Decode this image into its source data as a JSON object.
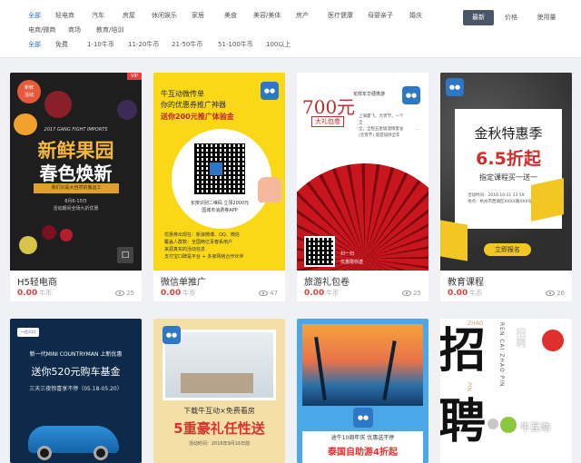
{
  "filters": {
    "row1": [
      "全部",
      "轻电商",
      "汽车",
      "房屋",
      "休闲娱乐",
      "家居",
      "美食",
      "美容/美体",
      "房产",
      "医疗健康",
      "母婴亲子",
      "婚庆"
    ],
    "row2": [
      "电商/微商",
      "商场",
      "教育/培训"
    ],
    "row3": [
      "全部",
      "免费",
      "1-10牛币",
      "11-20牛币",
      "21-50牛币",
      "51-100牛币",
      "100以上"
    ]
  },
  "sort": {
    "latest": "最新",
    "price": "价格",
    "usage": "使用量"
  },
  "cards": [
    {
      "title": "H5轻电商",
      "price": "0.00",
      "unit": "牛币",
      "views": "25",
      "thumb": {
        "badge": "新鲜\n活动",
        "vip": "VIP",
        "top": "2017 GANG FIGHT IMPORTS",
        "h1": "新鲜果园",
        "h2": "春色焕新",
        "sub": "我们只是大自然的搬运工",
        "date": "8月6-15日",
        "addr": "活动期间全场九折优惠"
      }
    },
    {
      "title": "微信单推广",
      "price": "0.00",
      "unit": "牛币",
      "views": "47",
      "thumb": {
        "l1": "牛互动微传单",
        "l2": "你的优惠券推广神器",
        "l3": "送你200元推广体验金",
        "cap1": "长按识别二维码 立领2000元",
        "cap2": "国城市消费券APP",
        "b1": "优惠券出现在：新浪微博、QQ、微信",
        "b2": "覆盖人群数：全国两亿青春系用户",
        "b3": "来源真实的活动信息",
        "b4": "支付宝口碑是平台 + 多家网络合作伙伴"
      }
    },
    {
      "title": "旅游礼包卷",
      "price": "0.00",
      "unit": "牛币",
      "views": "25",
      "thumb": {
        "price": "700元",
        "sub1": "大礼包卷",
        "brand": "花样年华便携游",
        "p1": "上海夏飞，元宵节，一个全",
        "p2": "全，全程五星级温情客舍",
        "p3": "(元宵节) 旅游加持全年",
        "sub2": "扫一扫",
        "sub3": "优惠限你送"
      }
    },
    {
      "title": "教育课程",
      "price": "0.00",
      "unit": "牛币",
      "views": "26",
      "thumb": {
        "h1": "金秋特惠季",
        "h2": "6.5折起",
        "sub": "指定课程买一送一",
        "d1": "活动时间：2016.10.31 23:59",
        "d2": "地点：杭州市西湖区XXXX路XXX号",
        "btn": "立即报名"
      }
    },
    {
      "thumb": {
        "logo": "一位人口",
        "l1": "新一代MINI COUNTRYMAN 上新优惠",
        "l2": "送你520元购车基金",
        "l3": "三天三夜惊喜享不停（05.18-05.20）"
      }
    },
    {
      "thumb": {
        "l1": "下载牛互动×免费看房",
        "l2": "5重豪礼任性送",
        "l3": "活动时间：2016年9月16日前"
      }
    },
    {
      "thumb": {
        "l1": "途牛10周年庆 优惠送不停",
        "l2": "泰国自助游4折起"
      }
    },
    {
      "thumb": {
        "zhao": "ZHAO",
        "c1": "招",
        "c2": "聘",
        "pin": "PIN",
        "side": "REN CAI ZHAO PIN",
        "small": "招聘",
        "wm": "牛互动"
      }
    }
  ],
  "colors": {
    "accent": "#2b6fd6",
    "price": "#e0403f",
    "sort_active": "#4a5568"
  }
}
